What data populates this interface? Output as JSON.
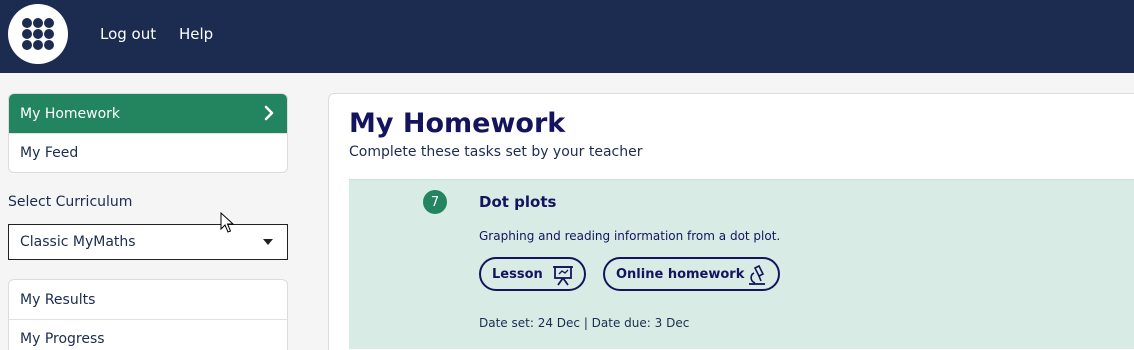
{
  "header": {
    "logo_icon": "grid-dots-icon",
    "links": [
      "Log out",
      "Help"
    ]
  },
  "sidebar": {
    "nav": [
      {
        "label": "My Homework",
        "active": true,
        "icon": "chevron-right-icon"
      },
      {
        "label": "My Feed",
        "active": false
      }
    ],
    "curriculum_label": "Select Curriculum",
    "curriculum_selected": "Classic MyMaths",
    "links": [
      "My Results",
      "My Progress"
    ]
  },
  "main": {
    "title": "My Homework",
    "subtitle": "Complete these tasks set by your teacher",
    "task": {
      "number": "7",
      "title": "Dot plots",
      "description": "Graphing and reading information from a dot plot.",
      "buttons": [
        {
          "label": "Lesson",
          "icon": "presentation-board-icon"
        },
        {
          "label": "Online homework",
          "icon": "microscope-icon"
        }
      ],
      "dates": "Date set: 24 Dec | Date due: 3 Dec"
    }
  },
  "colors": {
    "header_bg": "#1b2c50",
    "accent_green": "#228560",
    "task_bg": "#d8ece5",
    "text_navy": "#14145e"
  }
}
